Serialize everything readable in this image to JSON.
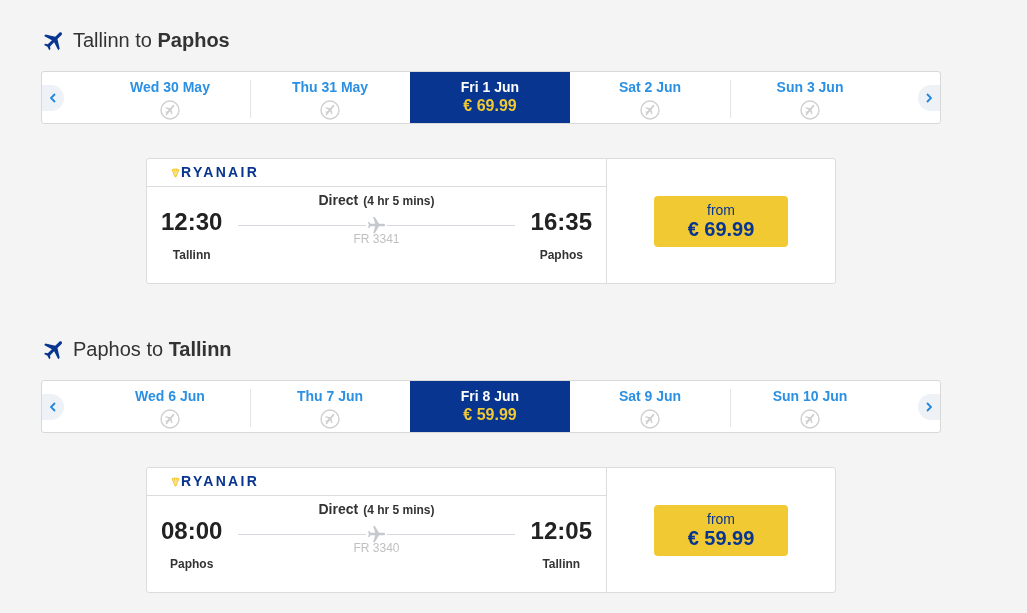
{
  "legs": [
    {
      "title": "Tallinn to **Paphos**",
      "dates": [
        {
          "label": "Wed 30 May",
          "selected": false
        },
        {
          "label": "Thu 31 May",
          "selected": false
        },
        {
          "label": "Fri 1 Jun",
          "selected": true,
          "price": "€ 69.99"
        },
        {
          "label": "Sat 2 Jun",
          "selected": false
        },
        {
          "label": "Sun 3 Jun",
          "selected": false
        }
      ],
      "flight": {
        "airline": "RYANAIR",
        "stops": "Direct",
        "duration": "(4 hr 5 mins)",
        "departure_time": "12:30",
        "departure_city": "Tallinn",
        "flight_number": "FR 3341",
        "arrival_time": "16:35",
        "arrival_city": "Paphos",
        "price_label": "from",
        "price": "€ 69.99"
      }
    },
    {
      "title": "Paphos to **Tallinn**",
      "dates": [
        {
          "label": "Wed 6 Jun",
          "selected": false
        },
        {
          "label": "Thu 7 Jun",
          "selected": false
        },
        {
          "label": "Fri 8 Jun",
          "selected": true,
          "price": "€ 59.99"
        },
        {
          "label": "Sat 9 Jun",
          "selected": false
        },
        {
          "label": "Sun 10 Jun",
          "selected": false
        }
      ],
      "flight": {
        "airline": "RYANAIR",
        "stops": "Direct",
        "duration": "(4 hr 5 mins)",
        "departure_time": "08:00",
        "departure_city": "Paphos",
        "flight_number": "FR 3340",
        "arrival_time": "12:05",
        "arrival_city": "Tallinn",
        "price_label": "from",
        "price": "€ 59.99"
      }
    }
  ]
}
